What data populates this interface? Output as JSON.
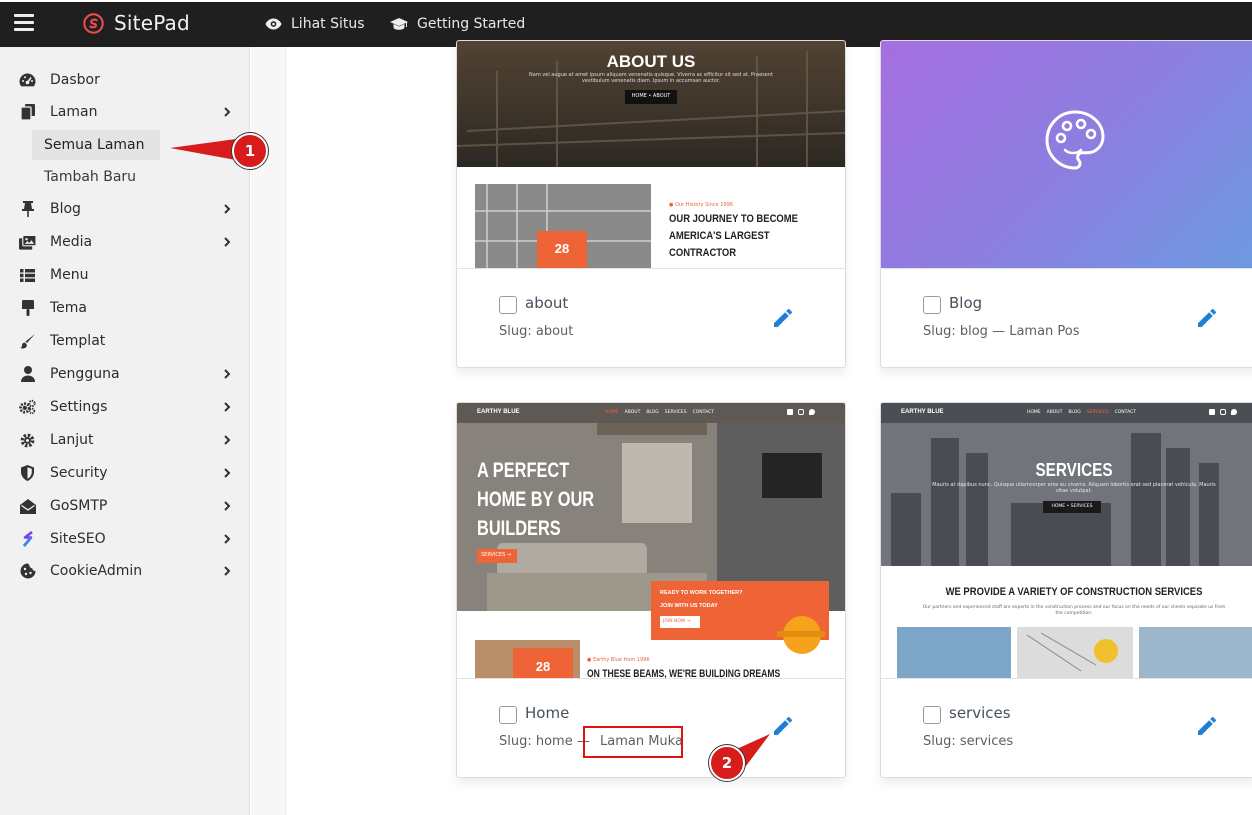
{
  "topbar": {
    "brand": "SitePad",
    "link_view_site": "Lihat Situs",
    "link_getting_started": "Getting Started"
  },
  "sidebar": {
    "items": [
      {
        "label": "Dasbor",
        "icon": "dashboard-icon"
      },
      {
        "label": "Laman",
        "icon": "pages-icon"
      },
      {
        "label": "Blog",
        "icon": "pin-icon"
      },
      {
        "label": "Media",
        "icon": "media-icon"
      },
      {
        "label": "Menu",
        "icon": "menu-list-icon"
      },
      {
        "label": "Tema",
        "icon": "paint-roller-icon"
      },
      {
        "label": "Templat",
        "icon": "brush-icon"
      },
      {
        "label": "Pengguna",
        "icon": "user-icon"
      },
      {
        "label": "Settings",
        "icon": "cogs-icon"
      },
      {
        "label": "Lanjut",
        "icon": "gear-icon"
      },
      {
        "label": "Security",
        "icon": "shield-icon"
      },
      {
        "label": "GoSMTP",
        "icon": "mail-icon"
      },
      {
        "label": "SiteSEO",
        "icon": "siteseo-icon"
      },
      {
        "label": "CookieAdmin",
        "icon": "cookie-icon"
      }
    ],
    "sub_items": [
      "Semua Laman",
      "Tambah Baru"
    ]
  },
  "cards": [
    {
      "title": "about",
      "slug": "Slug: about",
      "thumb": {
        "banner_title": "ABOUT US",
        "banner_text": "Nam vel augue at amet ipsum aliquam venenatis quisque. Viverra ac efficitur sit sed at. Praesent vestibulum venenatis diam. Ipsum in accumsan auctor.",
        "breadcrumb": "HOME • ABOUT",
        "badge": "28",
        "eyebrow": "● Our History Since 1996",
        "heading_1": "OUR JOURNEY TO BECOME",
        "heading_2": "AMERICA'S LARGEST",
        "heading_3": "CONTRACTOR"
      }
    },
    {
      "title": "Blog",
      "slug": "Slug: blog — Laman Pos"
    },
    {
      "title": "Home",
      "slug_prefix": "Slug: home —",
      "slug_suffix": "Laman Muka",
      "thumb": {
        "brand": "EARTHY BLUE",
        "nav": [
          "HOME",
          "ABOUT",
          "BLOG",
          "SERVICES",
          "CONTACT"
        ],
        "hero_1": "A PERFECT",
        "hero_2": "HOME BY OUR",
        "hero_3": "BUILDERS",
        "cta": "SERVICES →",
        "promo_1": "READY TO WORK TOGETHER?",
        "promo_2": "JOIN WITH US TODAY",
        "promo_btn": "JOIN NOW →",
        "badge": "28",
        "eyebrow": "● Earthy Blue from 1996",
        "heading": "ON THESE BEAMS, WE'RE BUILDING DREAMS"
      }
    },
    {
      "title": "services",
      "slug": "Slug: services",
      "thumb": {
        "brand": "EARTHY BLUE",
        "nav": [
          "HOME",
          "ABOUT",
          "BLOG",
          "SERVICES",
          "CONTACT"
        ],
        "banner_title": "SERVICES",
        "banner_text": "Mauris at dapibus nunc. Quisque ullamcorper eros eu viverra. Aliquam lobortis erat sed placerat vehicula. Mauris vitae volutpat.",
        "breadcrumb": "HOME • SERVICES",
        "heading": "WE PROVIDE A VARIETY OF CONSTRUCTION SERVICES",
        "subtext": "Our partners and experienced staff are experts in the construction process and our focus on the needs of our clients separate us from the competition."
      }
    }
  ],
  "annotations": {
    "callout_1": "1",
    "callout_2": "2"
  },
  "colors": {
    "accent_orange": "#ef6436",
    "brand_red": "#e84c4c",
    "edit_blue": "#1e7fd8",
    "callout_red": "#d81b1b"
  }
}
